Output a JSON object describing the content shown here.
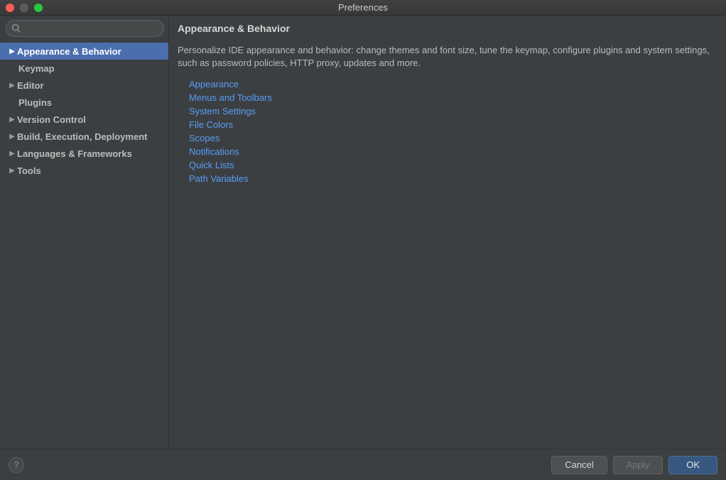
{
  "window": {
    "title": "Preferences"
  },
  "search": {
    "placeholder": ""
  },
  "sidebar": {
    "items": [
      {
        "label": "Appearance & Behavior",
        "expandable": true,
        "selected": true,
        "child": false
      },
      {
        "label": "Keymap",
        "expandable": false,
        "selected": false,
        "child": true
      },
      {
        "label": "Editor",
        "expandable": true,
        "selected": false,
        "child": false
      },
      {
        "label": "Plugins",
        "expandable": false,
        "selected": false,
        "child": true
      },
      {
        "label": "Version Control",
        "expandable": true,
        "selected": false,
        "child": false
      },
      {
        "label": "Build, Execution, Deployment",
        "expandable": true,
        "selected": false,
        "child": false
      },
      {
        "label": "Languages & Frameworks",
        "expandable": true,
        "selected": false,
        "child": false
      },
      {
        "label": "Tools",
        "expandable": true,
        "selected": false,
        "child": false
      }
    ]
  },
  "main": {
    "title": "Appearance & Behavior",
    "description": "Personalize IDE appearance and behavior: change themes and font size, tune the keymap, configure plugins and system settings, such as password policies, HTTP proxy, updates and more.",
    "links": [
      "Appearance",
      "Menus and Toolbars",
      "System Settings",
      "File Colors",
      "Scopes",
      "Notifications",
      "Quick Lists",
      "Path Variables"
    ]
  },
  "footer": {
    "help": "?",
    "cancel": "Cancel",
    "apply": "Apply",
    "ok": "OK"
  }
}
